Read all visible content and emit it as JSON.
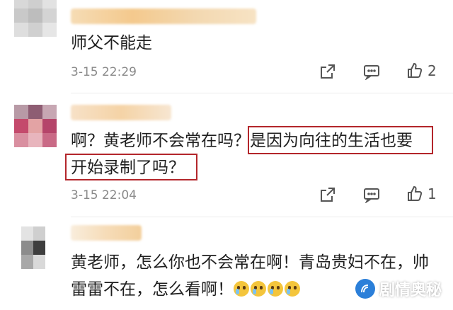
{
  "comments": [
    {
      "text": "师父不能走",
      "time": "3-15 22:29",
      "likes": "2"
    },
    {
      "text_part1": "啊？黄老师不会常在吗？",
      "text_part2": "是因为向往的生活也要",
      "text_line2": "开始录制了吗？",
      "time": "3-15 22:04",
      "likes": "1"
    },
    {
      "text_line1": "黄老师，怎么你也不会常在啊！青岛贵妇不在，帅",
      "text_line2": "雷雷不在，怎么看啊！"
    }
  ],
  "icons": {
    "share": "share-icon",
    "reply": "comment-icon",
    "like": "thumbs-up-icon",
    "emoji": "crying-face-emoji"
  },
  "colors": {
    "highlight_box": "#b3262b",
    "time_text": "#8a8a8a",
    "watermark_logo": "#2b7fd9"
  },
  "watermark": {
    "text": "剧情奥秘"
  }
}
